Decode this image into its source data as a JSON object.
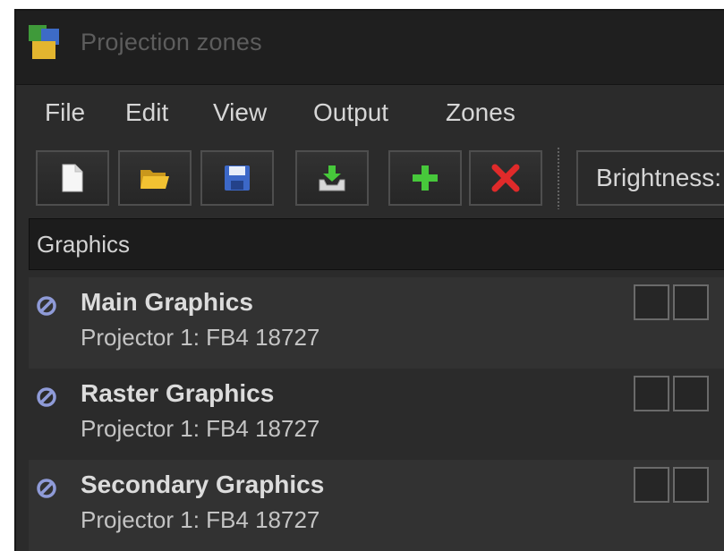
{
  "window": {
    "title": "Projection zones",
    "app_icon": "projection-zones-app-icon"
  },
  "menubar": {
    "items": [
      {
        "label": "File"
      },
      {
        "label": "Edit"
      },
      {
        "label": "View"
      },
      {
        "label": "Output"
      },
      {
        "label": "Zones"
      }
    ]
  },
  "toolbar": {
    "buttons": [
      {
        "icon": "new-document-icon"
      },
      {
        "icon": "open-folder-icon"
      },
      {
        "icon": "save-disk-icon"
      },
      {
        "icon": "export-icon"
      },
      {
        "icon": "add-icon"
      },
      {
        "icon": "delete-icon"
      }
    ],
    "brightness_label": "Brightness:"
  },
  "search": {
    "value": "Graphics"
  },
  "zones": [
    {
      "name": "Main Graphics",
      "projector": "Projector 1: FB4 18727",
      "icon": "disabled-icon"
    },
    {
      "name": "Raster Graphics",
      "projector": "Projector 1: FB4 18727",
      "icon": "disabled-icon"
    },
    {
      "name": "Secondary Graphics",
      "projector": "Projector 1: FB4 18727",
      "icon": "disabled-icon"
    }
  ],
  "colors": {
    "window_bg": "#2b2b2b",
    "titlebar_bg": "#1f1f1f",
    "text": "#d6d6d6",
    "disabled_icon": "#8f9bd8",
    "add_green": "#47c83b",
    "delete_red": "#e02a2a",
    "folder_yellow": "#f2c232",
    "save_blue": "#3c68c8"
  }
}
